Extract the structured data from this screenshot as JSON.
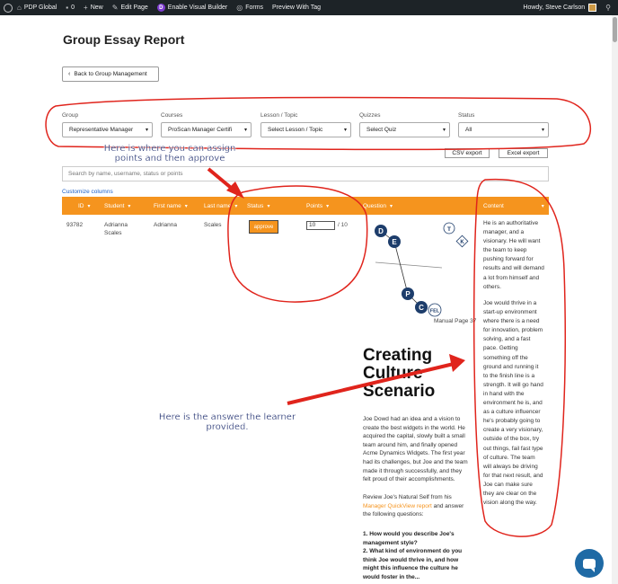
{
  "adminbar": {
    "site_name": "PDP Global",
    "comments_count": "0",
    "new_label": "New",
    "edit_page_label": "Edit Page",
    "visual_builder_label": "Enable Visual Builder",
    "forms_label": "Forms",
    "preview_label": "Preview With Tag",
    "greeting": "Howdy, Steve Carlson"
  },
  "page": {
    "title": "Group Essay Report",
    "back_button": "Back to Group Management"
  },
  "filters": [
    {
      "label": "Group",
      "value": "Representative Manager"
    },
    {
      "label": "Courses",
      "value": "ProScan Manager Certifi"
    },
    {
      "label": "Lesson / Topic",
      "value": "Select Lesson / Topic"
    },
    {
      "label": "Quizzes",
      "value": "Select Quiz"
    },
    {
      "label": "Status",
      "value": "All"
    }
  ],
  "exports": {
    "csv": "CSV export",
    "excel": "Excel export"
  },
  "search": {
    "placeholder": "Search by name, username, status or points"
  },
  "customize_columns": "Customize columns",
  "table": {
    "headers": [
      "ID",
      "Student",
      "First name",
      "Last name",
      "Status",
      "Points",
      "Question",
      "Content"
    ],
    "row": {
      "id": "93782",
      "student_line1": "Adrianna",
      "student_line2": "Scales",
      "first_name": "Adrianna",
      "last_name": "Scales",
      "status_button": "approve",
      "points_value": "10",
      "points_max": "/ 10"
    }
  },
  "question": {
    "diagram_labels": [
      "D",
      "E",
      "T",
      "K",
      "P",
      "C",
      "FEL"
    ],
    "manual_page": "Manual Page 37",
    "heading_line1": "Creating",
    "heading_line2": "Culture",
    "heading_line3": "Scenario",
    "para1": "Joe Dowd had an idea and a vision to create the best widgets in the world. He acquired the capital, slowly built a small team around him, and finally opened Acme Dynamics Widgets. The first year had its challenges, but Joe and the team made it through successfully, and they felt proud of their accomplishments.",
    "para2_before": "Review Joe's Natural Self from his ",
    "para2_link": "Manager QuickView report",
    "para2_after": " and answer the following questions:",
    "q1": "1. How would you describe Joe's management style?",
    "q2": "2. What kind of environment do you think Joe would thrive in, and how might this influence the culture he would foster in the..."
  },
  "content": {
    "para1": "He is an authoritative manager, and a visionary. He will want the team to keep pushing forward for results and will demand a lot from himself and others.",
    "para2": "Joe would thrive in a start-up environment where there is a need for innovation, problem solving, and a fast pace. Getting something off the ground and running it to the finish line is a strength. It will go hand in hand with the environment he is, and as a culture influencer he's probably going to create a very visionary, outside of the box, try out things, fail fast type of culture. The team will always be driving for that next result, and Joe can make sure they are clear on the vision along the way."
  },
  "annotations": {
    "top_line1": "Here is where you can assign",
    "top_line2": "points and then approve",
    "bottom_line1": "Here is the answer the learner",
    "bottom_line2": "provided."
  },
  "colors": {
    "accent": "#f5941e",
    "admin_bar": "#1d2327",
    "annotation_red": "#e0241c",
    "link_blue": "#1a5fc9"
  }
}
